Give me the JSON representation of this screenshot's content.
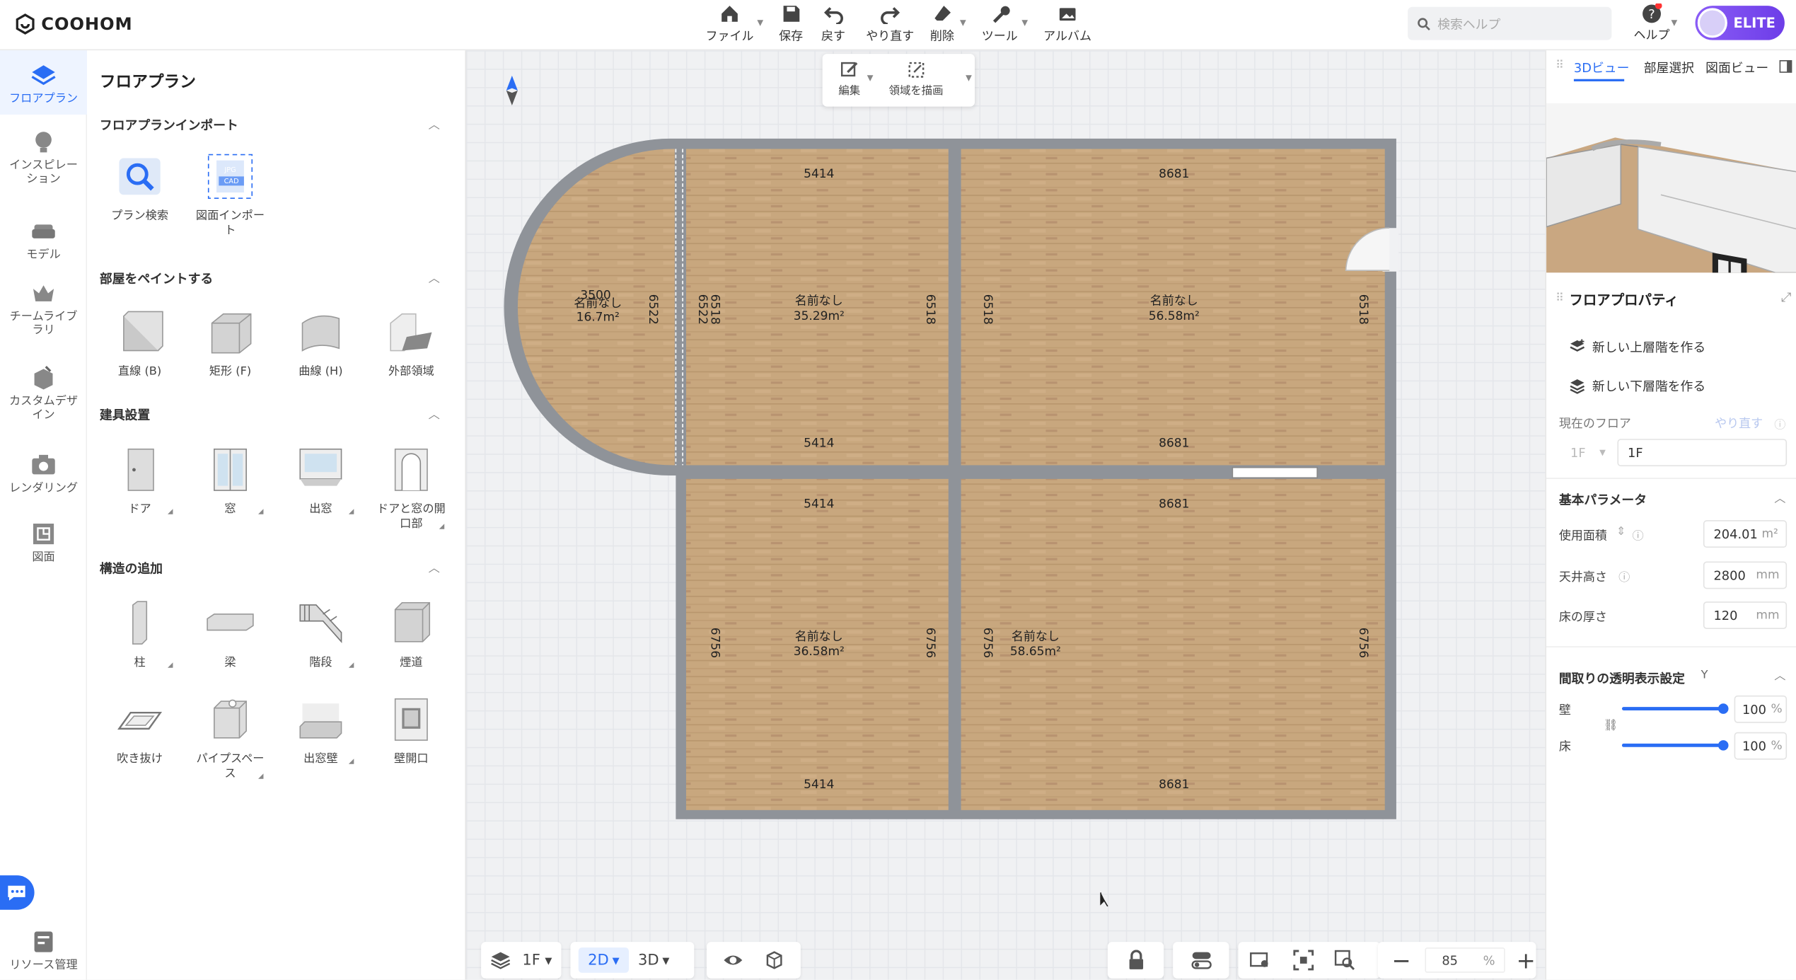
{
  "app": {
    "logo": "COOHOM"
  },
  "toolbar": {
    "file": "ファイル",
    "save": "保存",
    "undo": "戻す",
    "redo": "やり直す",
    "delete": "削除",
    "tools": "ツール",
    "album": "アルバム"
  },
  "search": {
    "placeholder": "検索ヘルプ"
  },
  "help": {
    "label": "ヘルプ"
  },
  "account": {
    "badge": "ELITE"
  },
  "rail": {
    "items": [
      {
        "label": "フロアプラン"
      },
      {
        "label": "インスピレーション"
      },
      {
        "label": "モデル"
      },
      {
        "label": "チームライブラリ"
      },
      {
        "label": "カスタムデザイン"
      },
      {
        "label": "レンダリング"
      },
      {
        "label": "図面"
      }
    ],
    "bottom": "リソース管理"
  },
  "panel": {
    "title": "フロアプラン",
    "sections": [
      {
        "title": "フロアプランインポート",
        "tiles": [
          "プラン検索",
          "図面インポート"
        ]
      },
      {
        "title": "部屋をペイントする",
        "tiles": [
          "直線 (B)",
          "矩形 (F)",
          "曲線 (H)",
          "外部領域"
        ]
      },
      {
        "title": "建具設置",
        "tiles": [
          "ドア",
          "窓",
          "出窓",
          "ドアと窓の開口部"
        ]
      },
      {
        "title": "構造の追加",
        "tiles": [
          "柱",
          "梁",
          "階段",
          "煙道",
          "吹き抜け",
          "パイプスペース",
          "出窓壁",
          "壁開口"
        ]
      }
    ]
  },
  "canvas": {
    "float_tools": {
      "edit": "編集",
      "draw_area": "領域を描画"
    },
    "rooms": [
      {
        "name": "名前なし",
        "area": "16.7m²",
        "dims": [
          "3500",
          "6522",
          "6522"
        ]
      },
      {
        "name": "名前なし",
        "area": "35.29m²",
        "dims": [
          "5414",
          "5414",
          "6518",
          "6518"
        ]
      },
      {
        "name": "名前なし",
        "area": "56.58m²",
        "dims": [
          "8681",
          "8681",
          "6518",
          "6518"
        ]
      },
      {
        "name": "名前なし",
        "area": "36.58m²",
        "dims": [
          "5414",
          "5414",
          "6756",
          "6756"
        ]
      },
      {
        "name": "名前なし",
        "area": "58.65m²",
        "dims": [
          "8681",
          "8681",
          "6756",
          "6756"
        ]
      }
    ],
    "bottom": {
      "floor": "1F",
      "mode_2d": "2D",
      "mode_3d": "3D",
      "zoom": "85",
      "zoom_unit": "%"
    }
  },
  "right": {
    "tabs": [
      "3Dビュー",
      "部屋選択",
      "図面ビュー"
    ],
    "props_title": "フロアプロパティ",
    "new_upper": "新しい上層階を作る",
    "new_lower": "新しい下層階を作る",
    "current_floor_label": "現在のフロア",
    "current_floor_action": "やり直す",
    "floor_select": "1F",
    "floor_name": "1F",
    "basic_title": "基本パラメータ",
    "params": [
      {
        "label": "使用面積",
        "value": "204.01",
        "unit": "m²"
      },
      {
        "label": "天井高さ",
        "value": "2800",
        "unit": "mm"
      },
      {
        "label": "床の厚さ",
        "value": "120",
        "unit": "mm"
      }
    ],
    "transparency_title": "間取りの透明表示設定",
    "transparency_suffix": "Y",
    "wall_label": "壁",
    "wall_value": "100",
    "floor_label": "床",
    "floor_value": "100",
    "percent": "%"
  },
  "colors": {
    "accent": "#2a6df4",
    "elite": "#7c4dff"
  }
}
